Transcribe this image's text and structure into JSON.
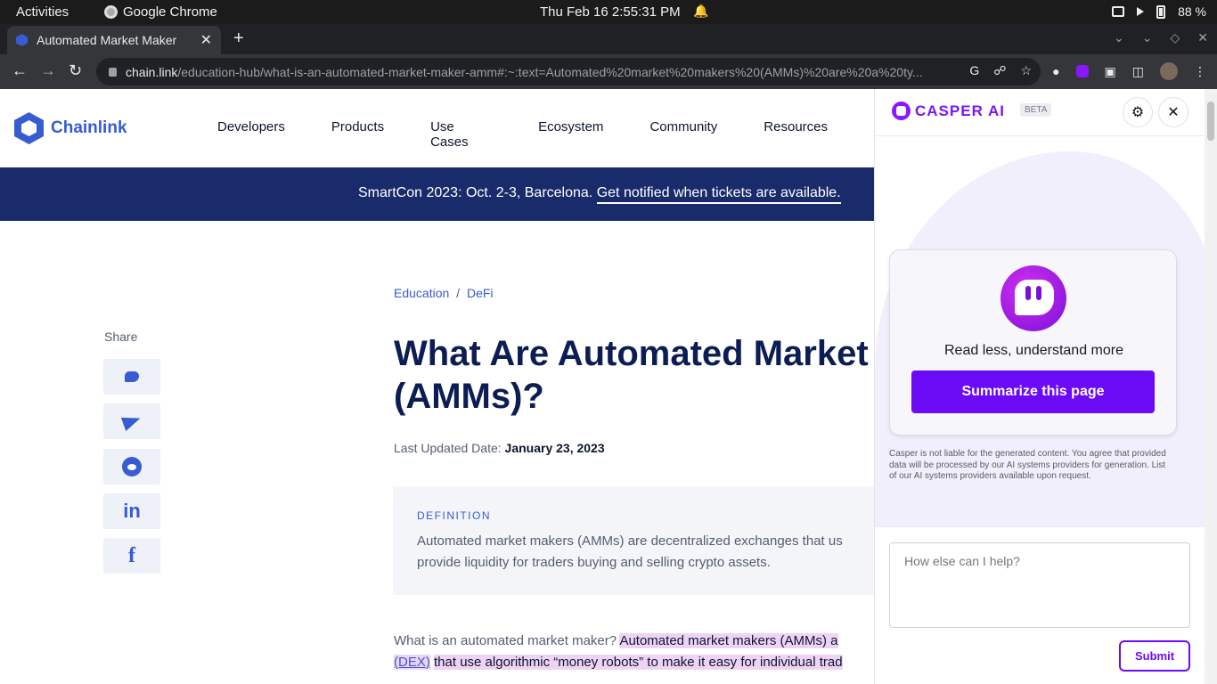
{
  "system_bar": {
    "activities": "Activities",
    "app_name": "Google Chrome",
    "datetime": "Thu Feb 16  2:55:31 PM",
    "battery": "88 %"
  },
  "browser": {
    "tab_title": "Automated Market Maker",
    "url_host": "chain.link",
    "url_path": "/education-hub/what-is-an-automated-market-maker-amm#:~:text=Automated%20market%20makers%20(AMMs)%20are%20a%20ty..."
  },
  "site": {
    "logo_text": "Chainlink",
    "nav": [
      "Developers",
      "Products",
      "Use Cases",
      "Ecosystem",
      "Community",
      "Resources"
    ],
    "banner_text": "SmartCon 2023: Oct. 2-3, Barcelona.",
    "banner_link": "Get notified when tickets are available.",
    "share_label": "Share",
    "breadcrumb_1": "Education",
    "breadcrumb_sep": "/",
    "breadcrumb_2": "DeFi",
    "headline_line1": "What Are Automated Market M",
    "headline_line2": "(AMMs)?",
    "updated_label": "Last Updated Date:",
    "updated_date": "January 23, 2023",
    "definition_label": "DEFINITION",
    "definition_text": "Automated market makers (AMMs) are decentralized exchanges that us provide liquidity for traders buying and selling crypto assets.",
    "para_q": "What is an automated market maker?",
    "para_hl_1": "Automated market makers (AMMs) a",
    "para_link": "(DEX)",
    "para_hl_2": "that use algorithmic “money robots” to make it easy for individual trad"
  },
  "casper": {
    "brand": "CASPER AI",
    "beta": "BETA",
    "tagline": "Read less, understand more",
    "summarize_label": "Summarize this page",
    "disclaimer": "Casper is not liable for the generated content. You agree that provided data will be processed by our AI systems providers for generation. List of our AI systems providers available upon request.",
    "input_placeholder": "How else can I help?",
    "submit_label": "Submit",
    "accent": "#6b0bf5"
  }
}
